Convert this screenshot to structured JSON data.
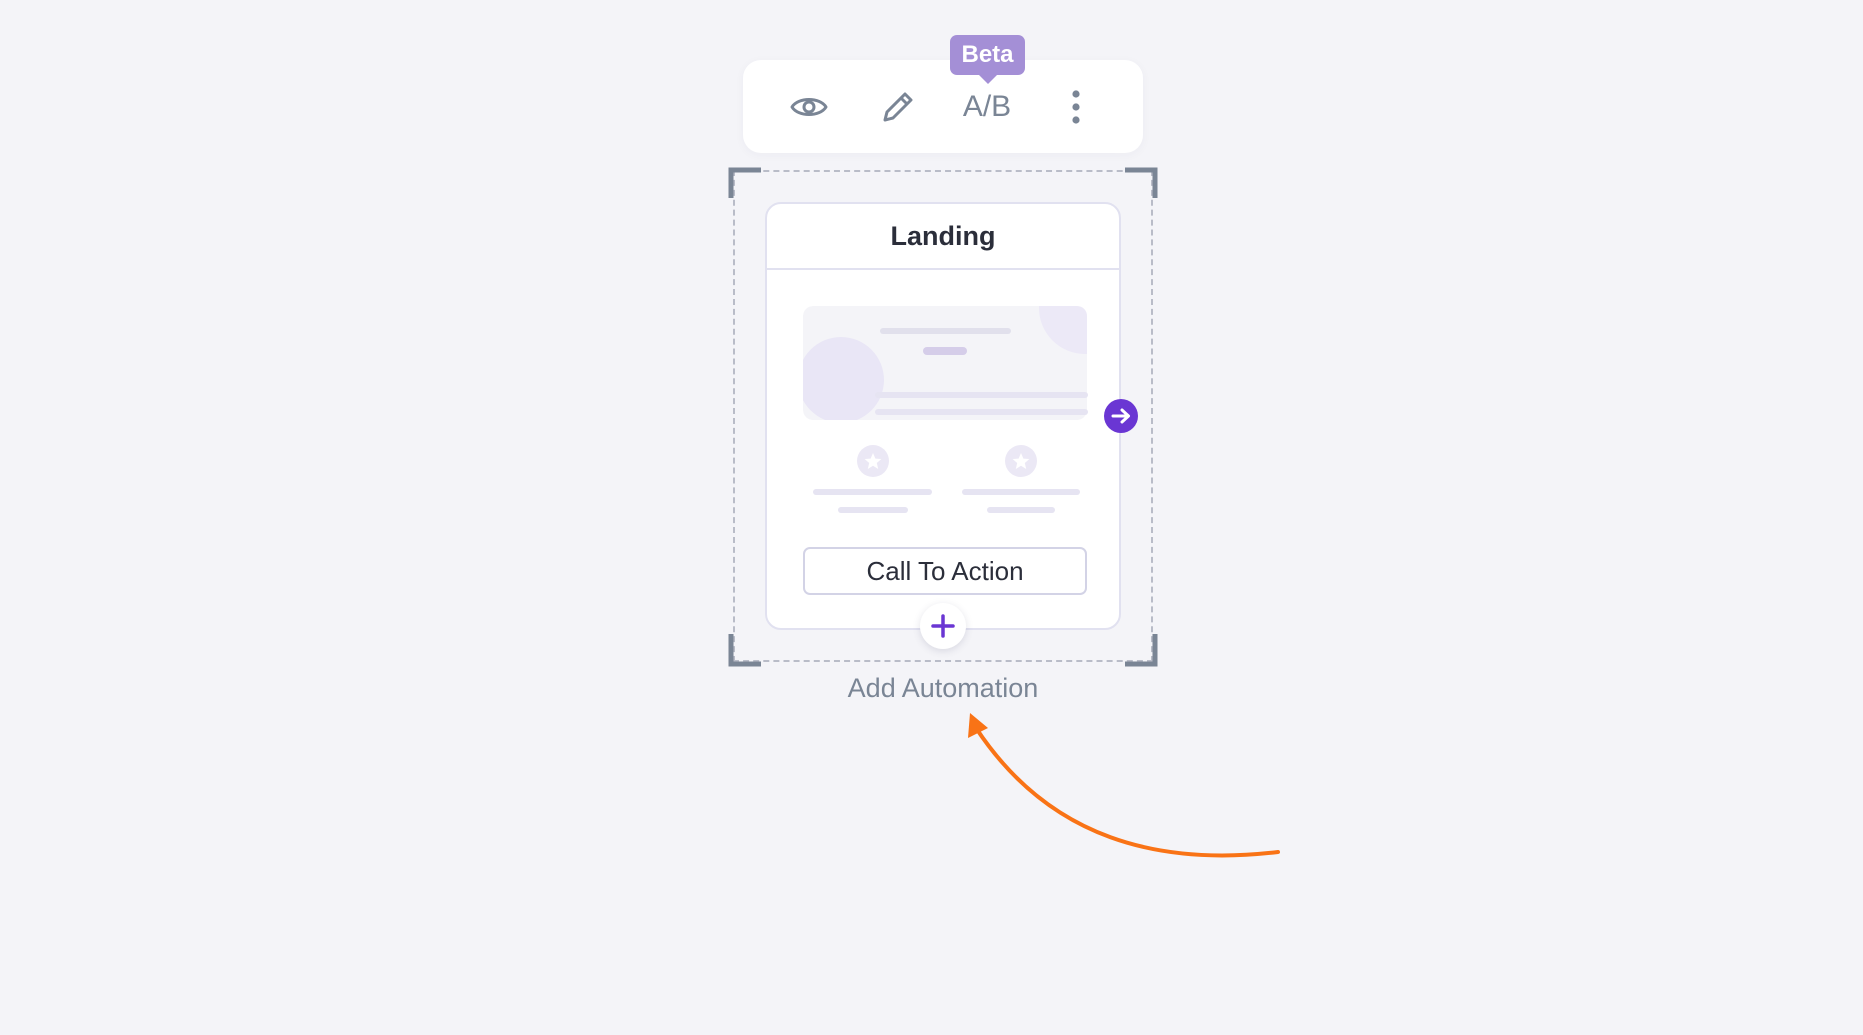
{
  "toolbar": {
    "preview_icon": "eye-icon",
    "edit_icon": "pencil-icon",
    "ab_label": "A/B",
    "more_icon": "vertical-dots-icon",
    "beta_badge": "Beta"
  },
  "node": {
    "title": "Landing",
    "cta_label": "Call To Action",
    "next_icon": "arrow-right-icon",
    "add_icon": "plus-icon"
  },
  "add_automation_label": "Add Automation",
  "colors": {
    "background": "#f4f4f8",
    "accent": "#6a36d3",
    "beta": "#a48fd6",
    "arrow": "#f97316",
    "icon": "#7a8595"
  }
}
